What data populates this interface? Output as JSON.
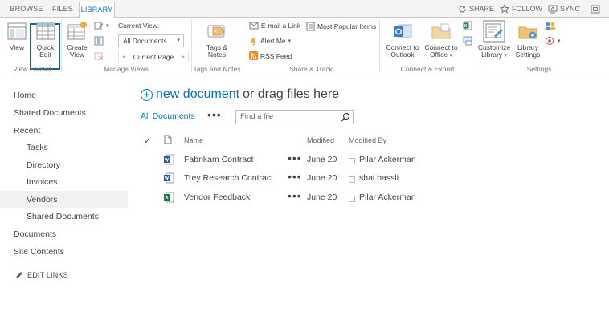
{
  "tabs": [
    "BROWSE",
    "FILES",
    "LIBRARY"
  ],
  "top_actions": [
    {
      "label": "SHARE",
      "icon": "share-icon"
    },
    {
      "label": "FOLLOW",
      "icon": "star-icon"
    },
    {
      "label": "SYNC",
      "icon": "sync-icon"
    },
    {
      "label": "",
      "icon": "focus-icon"
    }
  ],
  "ribbon": {
    "view": "View",
    "quick_edit": [
      "Quick",
      "Edit"
    ],
    "create_view": [
      "Create",
      "View"
    ],
    "current_view_label": "Current View:",
    "current_view_value": "All Documents",
    "current_page": "Current Page",
    "tags_notes": [
      "Tags &",
      "Notes"
    ],
    "email_link": "E-mail a Link",
    "alert_me": "Alert Me",
    "rss_feed": "RSS Feed",
    "most_popular": "Most Popular Items",
    "connect_outlook": [
      "Connect to",
      "Outlook"
    ],
    "connect_office": [
      "Connect to",
      "Office"
    ],
    "customize_library": [
      "Customize",
      "Library"
    ],
    "library_settings": [
      "Library",
      "Settings"
    ],
    "groups": [
      "View Format",
      "Manage Views",
      "Tags and Notes",
      "Share & Track",
      "Connect & Export",
      "Settings"
    ]
  },
  "nav": {
    "home": "Home",
    "shared_documents": "Shared Documents",
    "recent": "Recent",
    "recent_items": [
      "Tasks",
      "Directory",
      "Invoices",
      "Vendors",
      "Shared Documents"
    ],
    "documents": "Documents",
    "site_contents": "Site Contents",
    "edit_links": "EDIT LINKS"
  },
  "main": {
    "new_document": "new document",
    "drag_files": "or drag files here",
    "view_name": "All Documents",
    "find_placeholder": "Find a file",
    "columns": {
      "name": "Name",
      "modified": "Modified",
      "modified_by": "Modified By"
    },
    "rows": [
      {
        "name": "Fabrikam Contract",
        "modified": "June 20",
        "modified_by": "Pilar Ackerman",
        "icon": "word-doc-icon"
      },
      {
        "name": "Trey Research Contract",
        "modified": "June 20",
        "modified_by": "shai.bassli",
        "icon": "word-doc-icon"
      },
      {
        "name": "Vendor Feedback",
        "modified": "June 20",
        "modified_by": "Pilar Ackerman",
        "icon": "excel-doc-icon"
      }
    ]
  },
  "colors": {
    "accent": "#0072c6",
    "word": "#2b579a",
    "excel": "#217346",
    "quick_edit_frame": "#1f5f80"
  }
}
